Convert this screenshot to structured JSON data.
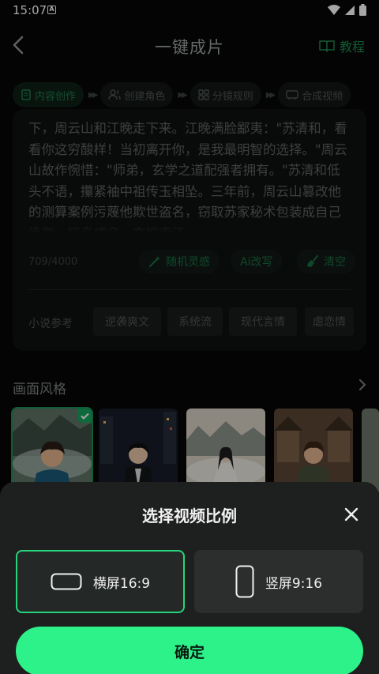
{
  "status_bar": {
    "time": "15:07",
    "notification_icon": "a-badge-icon"
  },
  "header": {
    "title": "一键成片",
    "tutorial_label": "教程"
  },
  "steps": [
    {
      "label": "内容创作",
      "icon": "document-icon",
      "active": true
    },
    {
      "label": "创建角色",
      "icon": "users-icon",
      "active": false
    },
    {
      "label": "分镜规则",
      "icon": "grid-icon",
      "active": false
    },
    {
      "label": "合成视频",
      "icon": "video-icon",
      "active": false
    }
  ],
  "editor": {
    "text": "下，周云山和江晚走下来。江晚满脸鄙夷：\"苏清和，看看你这穷酸样！当初离开你，是我最明智的选择。\"周云山故作惋惜：\"师弟，玄学之道配强者拥有。\"苏清和低头不语，攥紧袖中祖传玉相坠。三年前，周云山篡改他的测算案例污蔑他欺世盗名，窃取苏家秘术包装成自己绝学，摇身成名，夺婚事江",
    "char_count": "709/4000",
    "buttons": {
      "random": "随机灵感",
      "ai_rewrite": "Ai改写",
      "clear": "清空"
    }
  },
  "novel_reference": {
    "label": "小说参考",
    "tags": [
      "逆袭爽文",
      "系统流",
      "现代言情",
      "虐恋情"
    ]
  },
  "style_section": {
    "title": "画面风格"
  },
  "sheet": {
    "title": "选择视频比例",
    "options": [
      {
        "label": "横屏16:9",
        "selected": true
      },
      {
        "label": "竖屏9:16",
        "selected": false
      }
    ],
    "confirm_label": "确定"
  },
  "colors": {
    "accent": "#2df28a",
    "accent_dark": "#1a8e55",
    "sheet_bg": "#1e1f1f"
  }
}
